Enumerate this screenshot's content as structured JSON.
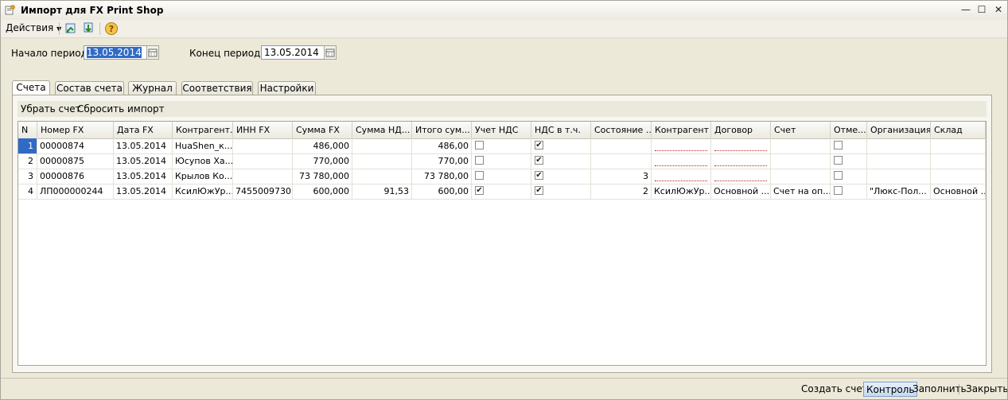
{
  "window": {
    "title": "Импорт для FX Print Shop",
    "min": "—",
    "max": "☐",
    "close": "✕"
  },
  "toolbar": {
    "actions_label": "Действия",
    "help": "?"
  },
  "period": {
    "start_label": "Начало периода:",
    "start_value": "13.05.2014",
    "end_label": "Конец периода:",
    "end_value": "13.05.2014"
  },
  "tabs": [
    "Счета",
    "Состав счета",
    "Журнал",
    "Соответствия",
    "Настройки"
  ],
  "subtoolbar": {
    "remove": "Убрать счет",
    "reset": "Сбросить импорт"
  },
  "table": {
    "headers": [
      "N",
      "Номер FX",
      "Дата FX",
      "Контрагент...",
      "ИНН FX",
      "Сумма FX",
      "Сумма НД...",
      "Итого сум...",
      "Учет НДС",
      "НДС в т.ч.",
      "Состояние ...",
      "Контрагент",
      "Договор",
      "Счет",
      "Отме...",
      "Организация",
      "Склад"
    ],
    "rows": [
      {
        "n": "1",
        "number": "00000874",
        "date": "13.05.2014",
        "counterparty_fx": "HuaShen_к...",
        "inn": "",
        "sum": "486,000",
        "vat_sum": "",
        "total": "486,00",
        "vat_account": false,
        "vat_included": true,
        "state": "",
        "counterparty": "",
        "contract": "",
        "account": "",
        "mark": false,
        "org": "",
        "warehouse": ""
      },
      {
        "n": "2",
        "number": "00000875",
        "date": "13.05.2014",
        "counterparty_fx": "Юсупов Ха...",
        "inn": "",
        "sum": "770,000",
        "vat_sum": "",
        "total": "770,00",
        "vat_account": false,
        "vat_included": true,
        "state": "",
        "counterparty": "",
        "contract": "",
        "account": "",
        "mark": false,
        "org": "",
        "warehouse": ""
      },
      {
        "n": "3",
        "number": "00000876",
        "date": "13.05.2014",
        "counterparty_fx": "Крылов Ко...",
        "inn": "",
        "sum": "73 780,000",
        "vat_sum": "",
        "total": "73 780,00",
        "vat_account": false,
        "vat_included": true,
        "state": "3",
        "counterparty": "",
        "contract": "",
        "account": "",
        "mark": false,
        "org": "",
        "warehouse": ""
      },
      {
        "n": "4",
        "number": "ЛП000000244",
        "date": "13.05.2014",
        "counterparty_fx": "КсилЮжУр...",
        "inn": "7455009730",
        "sum": "600,000",
        "vat_sum": "91,53",
        "total": "600,00",
        "vat_account": true,
        "vat_included": true,
        "state": "2",
        "counterparty": "КсилЮжУр...",
        "contract": "Основной ...",
        "account": "Счет на оп...",
        "mark": false,
        "org": "\"Люкс-Пол...",
        "warehouse": "Основной ..."
      }
    ]
  },
  "bottom": {
    "create": "Создать счета",
    "control": "Контроль",
    "fill": "Заполнить",
    "close": "Закрыть"
  }
}
